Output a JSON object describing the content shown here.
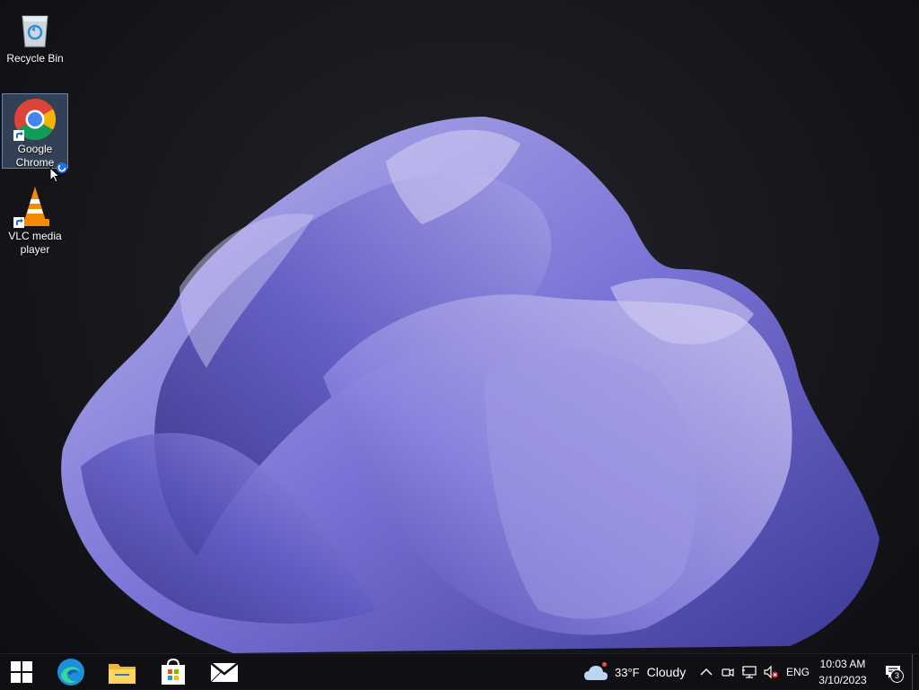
{
  "desktop": {
    "icons": [
      {
        "label": "Recycle Bin",
        "icon": "recycle-bin-icon"
      },
      {
        "label": "Google Chrome",
        "icon": "chrome-icon",
        "selected": true
      },
      {
        "label": "VLC media player",
        "icon": "vlc-icon"
      }
    ]
  },
  "taskbar": {
    "pinned": [
      {
        "name": "Start",
        "icon": "windows-start-icon"
      },
      {
        "name": "Microsoft Edge",
        "icon": "edge-icon"
      },
      {
        "name": "File Explorer",
        "icon": "file-explorer-icon"
      },
      {
        "name": "Microsoft Store",
        "icon": "store-icon"
      },
      {
        "name": "Mail",
        "icon": "mail-icon"
      }
    ],
    "weather": {
      "temp": "33°F",
      "condition": "Cloudy",
      "icon": "cloud-icon"
    },
    "language": "ENG",
    "clock": {
      "time": "10:03 AM",
      "date": "3/10/2023"
    },
    "notifications": {
      "count": "3",
      "icon": "notification-icon"
    }
  },
  "colors": {
    "taskbar": "#101014",
    "wallpaper_petal": "#6b68c8",
    "accent": "#0078d4"
  }
}
